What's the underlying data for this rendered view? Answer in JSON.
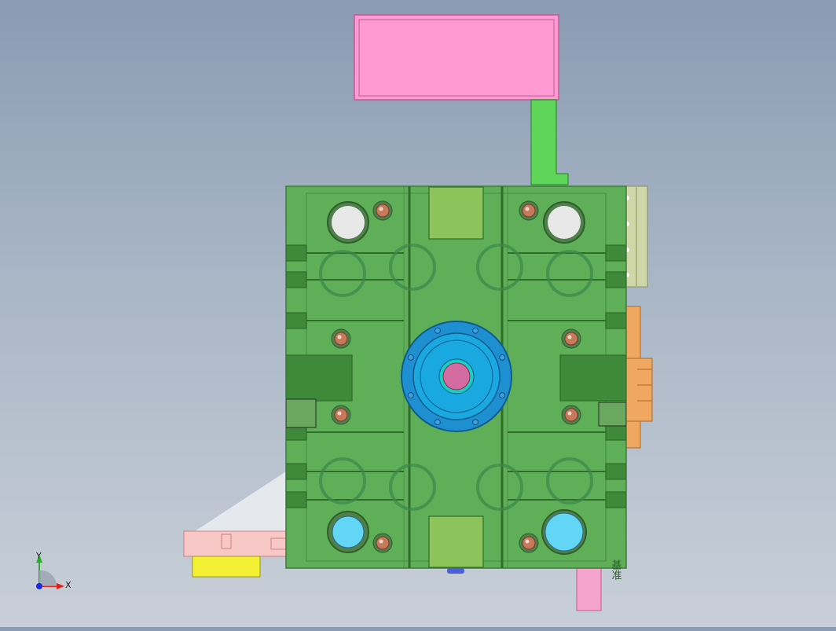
{
  "viewport": {
    "background_top": "#8a9bb2",
    "background_bottom": "#c8cfd8"
  },
  "triad": {
    "x_label": "X",
    "y_label": "Y",
    "x_color": "#e0201a",
    "y_color": "#23b023",
    "z_color": "#1a2be0"
  },
  "model": {
    "plate_color": "#5fae58",
    "plate_edge": "#3f7d3a",
    "hopper_color": "#ff9ad2",
    "bracket_color": "#5fd65a",
    "rack_color": "#cfd6a8",
    "side_block_color": "#f0a860",
    "red_block_color": "#e04848",
    "sprue_ring_color": "#1e8fd0",
    "sprue_inner_color": "#1aa8e0",
    "sprue_center_color": "#d36aa0",
    "pin_color": "#c77a5a",
    "bore_color": "#e8e8e8",
    "coolant_color": "#62d6f4",
    "chute_color": "#f8c8c8",
    "yellow_block_color": "#f4f033",
    "pink_leg_color": "#f4a4cc",
    "engraving_text": "基准"
  }
}
